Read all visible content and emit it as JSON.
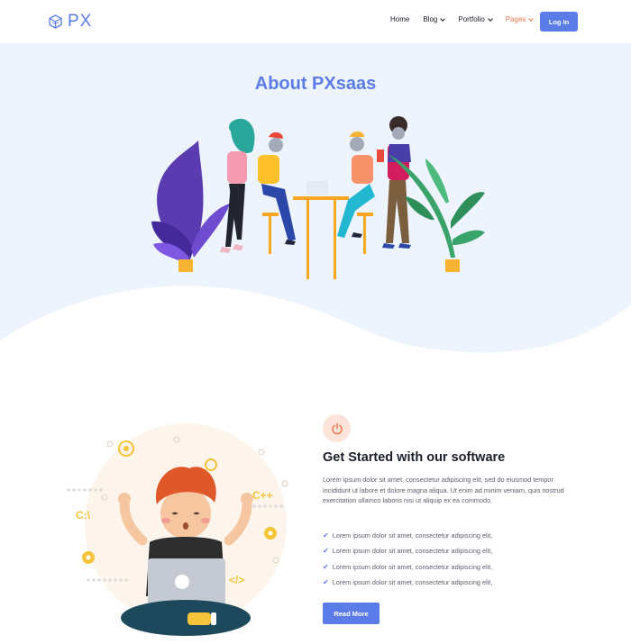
{
  "header": {
    "logo_text": "PX",
    "nav": [
      {
        "label": "Home"
      },
      {
        "label": "Blog"
      },
      {
        "label": "Portfolio"
      },
      {
        "label": "Pages"
      }
    ],
    "login_label": "Log In"
  },
  "hero": {
    "title": "About PXsaas"
  },
  "feature": {
    "title": "Get Started with our software",
    "description": "Lorem ipsum dolor sit amet, consectetur adipiscing elit, sed do eiusmod tempor incididunt ut labore et dolore magna aliqua. Ut enim ad minim veniam, quis nostrud exercitation ullamco laboris nisi ut aliquip ex ea commodo.",
    "list": [
      "Lorem ipsum dolor sit amet, consectetur adipiscing elit,",
      "Lorem ipsum dolor sit amet, consectetur adipiscing elit,",
      "Lorem ipsum dolor sit amet, consectetur adipiscing elit,",
      "Lorem ipsum dolor sit amet, consectetur adipiscing elit,"
    ],
    "button_label": "Read More",
    "laptop_tag": "</>",
    "code_tags": [
      "C++",
      "C:\\"
    ]
  },
  "colors": {
    "primary": "#5b7be9",
    "accent": "#f0784f",
    "hero_bg": "#eef4fd"
  },
  "icons": {
    "logo": "cube-logo-icon",
    "feature": "power-icon",
    "check": "check-icon"
  }
}
